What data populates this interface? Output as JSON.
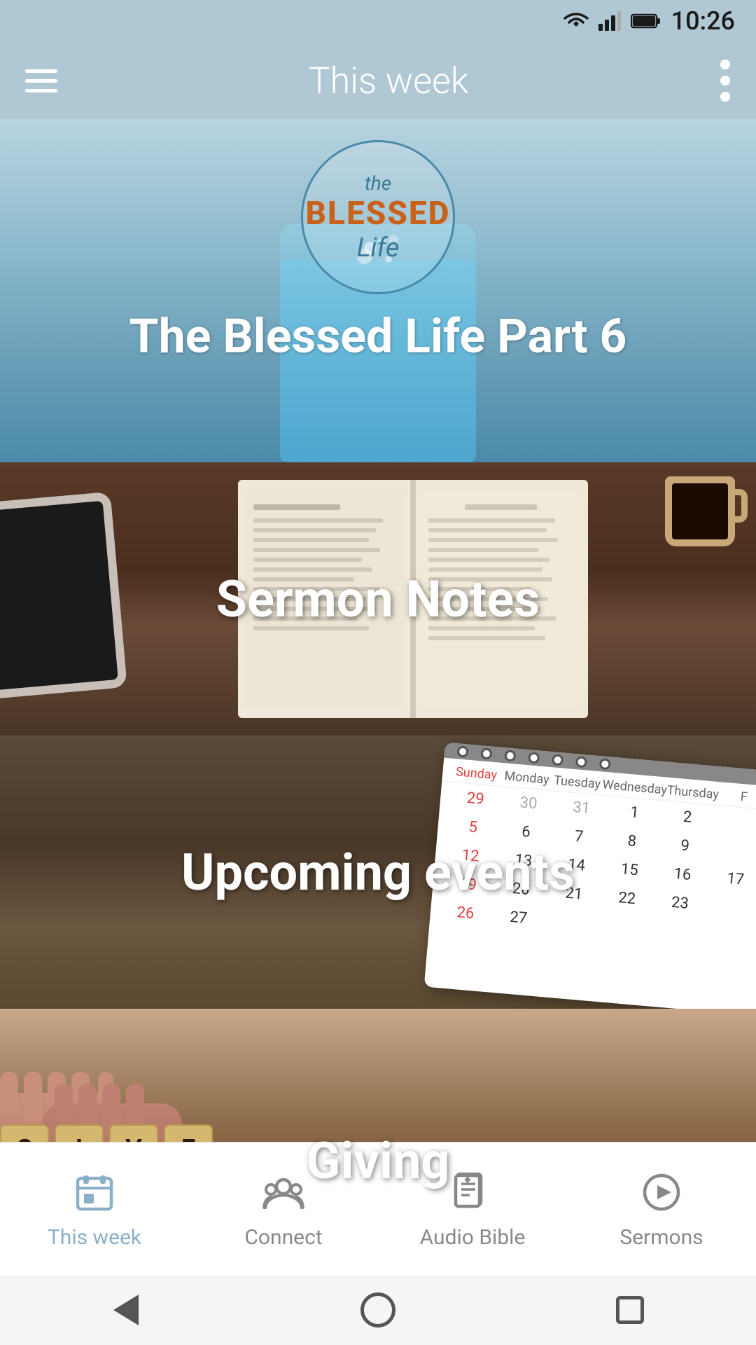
{
  "statusBar": {
    "time": "10:26"
  },
  "header": {
    "title": "This week",
    "menuIcon": "hamburger",
    "moreIcon": "more-vertical"
  },
  "hero": {
    "logoThe": "the",
    "logoBlessed": "BLESSED",
    "logoLife": "Life",
    "title": "The Blessed Life Part 6"
  },
  "cards": [
    {
      "id": "sermon-notes",
      "title": "Sermon Notes"
    },
    {
      "id": "upcoming-events",
      "title": "Upcoming events"
    },
    {
      "id": "giving",
      "title": "Giving"
    }
  ],
  "calendar": {
    "dayNames": [
      "Sunday",
      "Monday",
      "Tuesday",
      "Wednesday",
      "Thursday",
      "F"
    ],
    "dates": [
      [
        "29",
        "30",
        "31",
        "1",
        "2",
        ""
      ],
      [
        "5",
        "6",
        "7",
        "8",
        "9",
        ""
      ],
      [
        "12",
        "13",
        "14",
        "15",
        "16",
        "17"
      ],
      [
        "19",
        "20",
        "21",
        "22",
        "23",
        ""
      ],
      [
        "26",
        "27",
        ""
      ]
    ],
    "redDates": [
      "29",
      "5",
      "12",
      "19",
      "26"
    ],
    "grayDates": [
      "29",
      "30",
      "31"
    ]
  },
  "scrabbleTiles": [
    "G",
    "I",
    "V",
    "E"
  ],
  "bottomNav": {
    "items": [
      {
        "id": "this-week",
        "label": "This week",
        "active": true
      },
      {
        "id": "connect",
        "label": "Connect",
        "active": false
      },
      {
        "id": "audio-bible",
        "label": "Audio Bible",
        "active": false
      },
      {
        "id": "sermons",
        "label": "Sermons",
        "active": false
      }
    ]
  }
}
